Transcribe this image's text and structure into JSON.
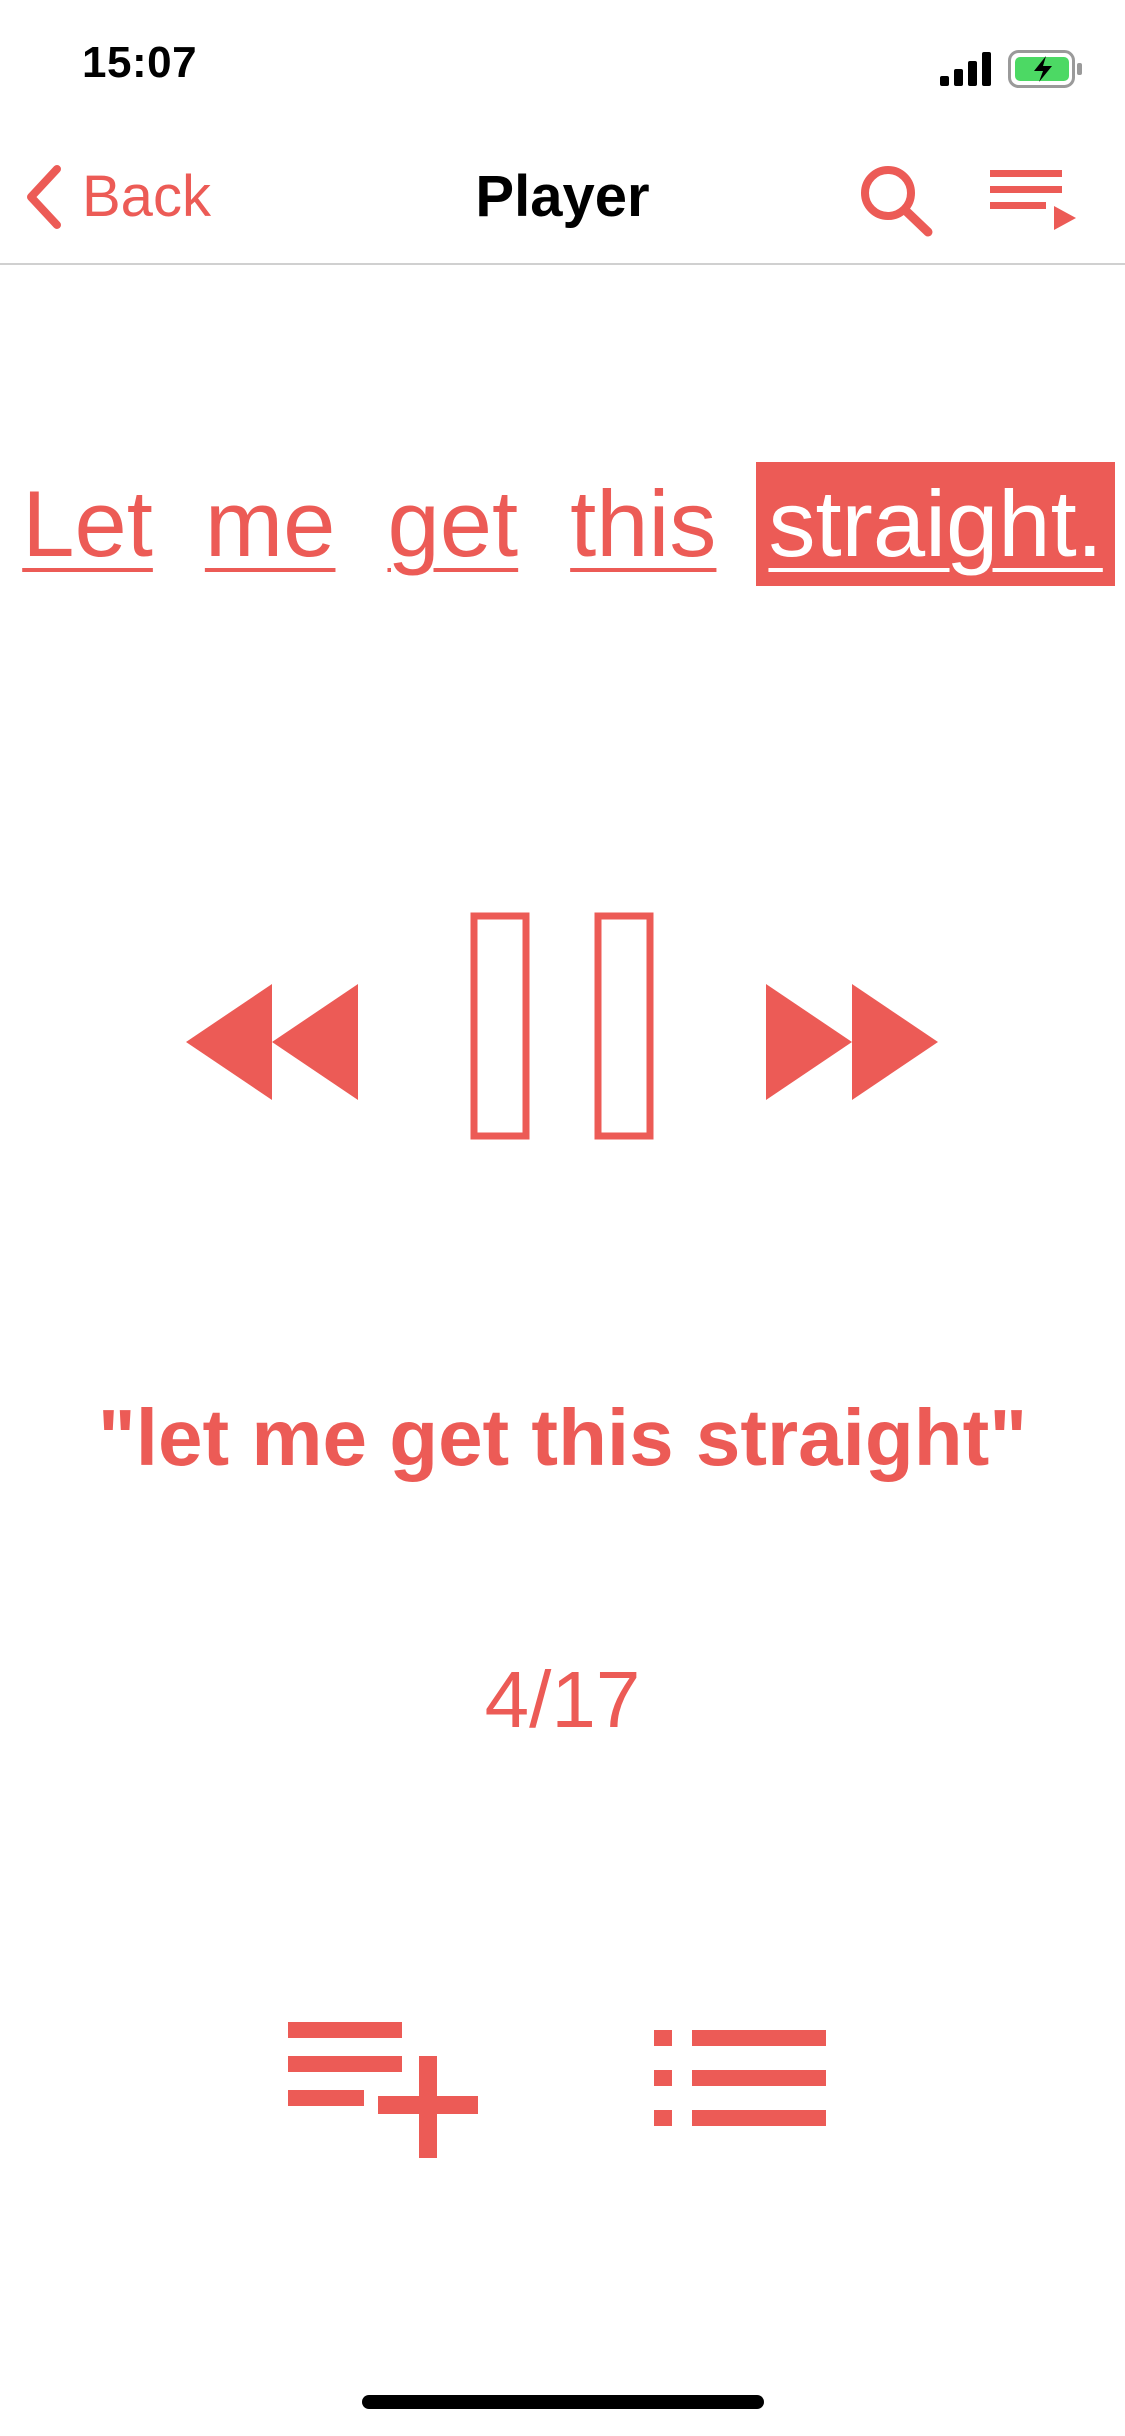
{
  "status_bar": {
    "time": "15:07",
    "signal_icon": "cellular-signal-icon",
    "battery_icon": "battery-charging-icon",
    "battery_color": "#4cd964"
  },
  "nav": {
    "back_label": "Back",
    "title": "Player",
    "search_icon": "search-icon",
    "queue_icon": "playlist-play-icon"
  },
  "sentence": {
    "words": [
      "Let",
      "me",
      "get",
      "this",
      "straight."
    ],
    "active_index": 4
  },
  "controls": {
    "rewind_icon": "rewind-icon",
    "pause_icon": "pause-icon",
    "forward_icon": "fast-forward-icon"
  },
  "phrase": "\"let me get this straight\"",
  "counter": "4/17",
  "actions": {
    "add_to_queue_icon": "playlist-add-icon",
    "list_icon": "list-icon"
  },
  "colors": {
    "accent": "#ec5b56",
    "text": "#000000",
    "divider": "#d0d0d0"
  }
}
